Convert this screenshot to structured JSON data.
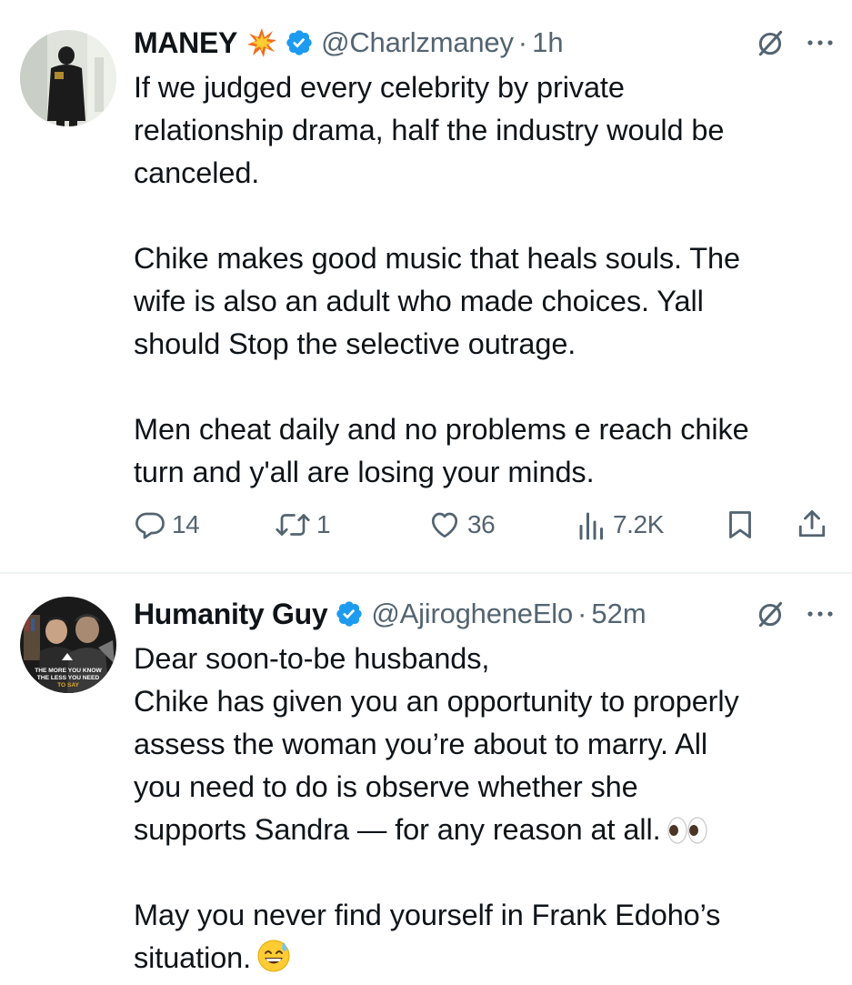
{
  "tweets": [
    {
      "display_name": "MANEY",
      "handle": "@Charlzmaney",
      "separator": "·",
      "time": "1h",
      "lines": [
        "If we judged every celebrity by private",
        "relationship drama, half the industry would be",
        "canceled.",
        "",
        "Chike makes good music that heals souls. The",
        "wife is also an adult who made choices. Yall",
        "should Stop the selective outrage.",
        "",
        "Men cheat daily and no problems e reach chike",
        "turn and y'all are losing your minds."
      ],
      "stats": {
        "replies": "14",
        "reposts": "1",
        "likes": "36",
        "views": "7.2K"
      }
    },
    {
      "display_name": "Humanity Guy",
      "handle": "@AjirogheneElo",
      "separator": "·",
      "time": "52m",
      "lines": [
        "Dear soon-to-be husbands,",
        "Chike has given you an opportunity to properly",
        "assess the woman you’re about to marry. All",
        "you need to do is observe whether she",
        "supports Sandra — for any reason at all.",
        "",
        "May you never find yourself in Frank Edoho’s",
        "situation."
      ],
      "avatar_text": [
        "THE MORE YOU KNOW",
        "THE LESS YOU NEED",
        "TO SAY"
      ]
    }
  ],
  "icons": {
    "name_emoji": "collision-emoji",
    "verified": "verified-badge-icon",
    "grok": "grok-icon",
    "more": "more-dots-icon",
    "eyes": "eyes-emoji",
    "sweat_smile": "grinning-sweat-emoji",
    "reply": "reply-icon",
    "repost": "repost-icon",
    "like": "like-icon",
    "views": "views-icon",
    "bookmark": "bookmark-icon",
    "share": "share-icon"
  },
  "colors": {
    "text": "#0f1419",
    "secondary": "#536471",
    "verified": "#1d9bf0",
    "divider": "#eff3f4"
  }
}
